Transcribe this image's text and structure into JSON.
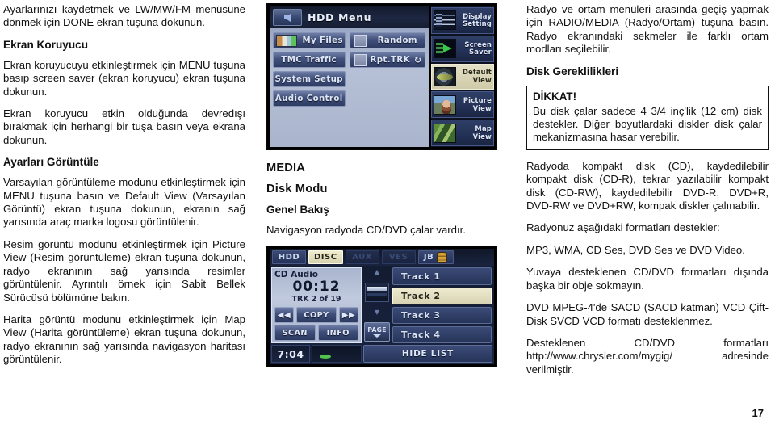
{
  "page": {
    "folio": "17"
  },
  "left_column": {
    "paragraphs": [
      "Ayarlarınızı kaydetmek ve LW/MW/FM menüsüne dönmek için DONE ekran tuşuna dokunun."
    ],
    "heading_screensaver": "Ekran Koruyucu",
    "screensaver_paragraphs": [
      "Ekran koruyucuyu etkinleştirmek için MENU tuşuna basıp screen saver (ekran koruyucu) ekran tuşuna dokunun.",
      "Ekran koruyucu etkin olduğunda devredışı bırakmak için herhangi bir tuşa basın veya ekrana dokunun."
    ],
    "heading_viewsettings": "Ayarları Görüntüle",
    "viewsettings_paragraphs": [
      "Varsayılan görüntüleme modunu etkinleştirmek için MENU tuşuna basın ve Default View (Varsayılan Görüntü) ekran tuşuna dokunun, ekranın sağ yarısında araç marka logosu görüntülenir.",
      "Resim görüntü modunu etkinleştirmek için Picture View (Resim görüntüleme) ekran tuşuna dokunun, radyo ekranının sağ yarısında resimler görüntülenir. Ayrıntılı örnek için Sabit Bellek Sürücüsü bölümüne bakın.",
      "Harita görüntü modunu etkinleştirmek için Map View (Harita görüntüleme) ekran tuşuna dokunun, radyo ekranının sağ yarısında navigasyon haritası görüntülenir."
    ]
  },
  "hdd_screen": {
    "title": "HDD Menu",
    "back_icon": "back-arrow-icon",
    "left_buttons": [
      {
        "label": "My Files",
        "icon": "files-icon"
      },
      {
        "label": "TMC Traffic",
        "icon": ""
      },
      {
        "label": "System Setup",
        "icon": ""
      },
      {
        "label": "Audio Control",
        "icon": ""
      }
    ],
    "right_buttons": [
      {
        "label": "Random",
        "checkbox": true,
        "glyph": ""
      },
      {
        "label": "Rpt.TRK",
        "checkbox": true,
        "glyph": "↻"
      }
    ],
    "sidebar": [
      {
        "line1": "Display",
        "line2": "Setting",
        "selected": false,
        "thumb": "display-thumb"
      },
      {
        "line1": "Screen",
        "line2": "Saver",
        "selected": false,
        "thumb": "screen-thumb"
      },
      {
        "line1": "Default",
        "line2": "View",
        "selected": true,
        "thumb": "default-thumb"
      },
      {
        "line1": "Picture",
        "line2": "View",
        "selected": false,
        "thumb": "picture-thumb"
      },
      {
        "line1": "Map",
        "line2": "View",
        "selected": false,
        "thumb": "map-thumb"
      }
    ]
  },
  "mid_column": {
    "section": "MEDIA",
    "subsection": "Disk Modu",
    "subsubsection": "Genel Bakış",
    "paragraph": "Navigasyon radyoda CD/DVD çalar vardır."
  },
  "cd_screen": {
    "tabs": [
      {
        "label": "HDD",
        "state": "normal"
      },
      {
        "label": "DISC",
        "state": "active"
      },
      {
        "label": "AUX",
        "state": "dim"
      },
      {
        "label": "VES",
        "state": "dim"
      },
      {
        "label": "JB",
        "state": "normal",
        "icon": "jukebox-icon"
      }
    ],
    "source_label": "CD Audio",
    "elapsed_time": "00:12",
    "track_status": "TRK 2 of 19",
    "transport": {
      "prev": "◀◀",
      "copy": "COPY",
      "next": "▶▶",
      "scan": "SCAN",
      "info": "INFO"
    },
    "scroll": {
      "up_glyph": "▲",
      "down_glyph": "▼",
      "page_label": "PAGE"
    },
    "tracks": [
      {
        "label": "Track 1",
        "selected": false
      },
      {
        "label": "Track 2",
        "selected": true
      },
      {
        "label": "Track 3",
        "selected": false
      },
      {
        "label": "Track 4",
        "selected": false
      }
    ],
    "clock": "7:04",
    "hide_list": "HIDE LIST"
  },
  "right_column": {
    "intro_paragraph": "Radyo ve ortam menüleri arasında geçiş yapmak için RADIO/MEDIA (Radyo/Ortam) tuşuna basın. Radyo ekranındaki sekmeler ile farklı ortam modları seçilebilir.",
    "heading_disk": "Disk Gereklilikleri",
    "caution": {
      "title": "DİKKAT!",
      "text": "Bu disk çalar sadece 4 3/4 inç'lik (12 cm) disk destekler. Diğer boyutlardaki diskler disk çalar mekanizmasına hasar verebilir."
    },
    "paragraphs": [
      "Radyoda kompakt disk (CD), kaydedilebilir kompakt disk (CD-R), tekrar yazılabilir kompakt disk (CD-RW), kaydedilebilir DVD-R, DVD+R, DVD-RW ve DVD+RW, kompak diskler çalınabilir.",
      "Radyonuz aşağıdaki formatları destekler:",
      "MP3, WMA, CD Ses, DVD Ses ve DVD Video.",
      "Yuvaya desteklenen CD/DVD formatları dışında başka bir obje sokmayın.",
      "DVD MPEG-4'de SACD (SACD katman) VCD Çift-Disk SVCD VCD formatı desteklenmez.",
      "Desteklenen CD/DVD formatları http://www.chrysler.com/mygig/ adresinde verilmiştir."
    ]
  }
}
